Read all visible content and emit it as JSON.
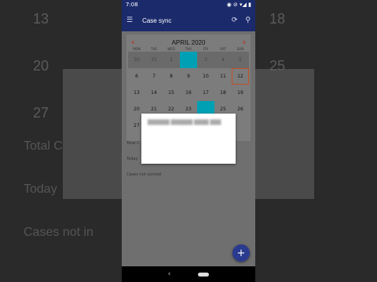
{
  "status_bar": {
    "time": "7:08",
    "right_icons": "◉ ⊘ ▾◢ ▮"
  },
  "app_bar": {
    "title": "Case sync",
    "menu_icon": "☰",
    "sync_icon": "⟳",
    "search_icon": "⚲"
  },
  "calendar": {
    "month_label": "APRIL 2020",
    "prev_icon": "‹",
    "next_icon": "›",
    "weekdays": [
      "MON",
      "TUE",
      "WED",
      "THU",
      "FRI",
      "SAT",
      "SUN"
    ],
    "weeks": [
      [
        {
          "d": "30",
          "out": true
        },
        {
          "d": "31",
          "out": true
        },
        {
          "d": "1",
          "out": true
        },
        {
          "d": "",
          "out": true,
          "sel": true
        },
        {
          "d": "3",
          "out": true
        },
        {
          "d": "4",
          "out": true
        },
        {
          "d": "5",
          "out": true
        }
      ],
      [
        {
          "d": "6"
        },
        {
          "d": "7"
        },
        {
          "d": "8"
        },
        {
          "d": "9"
        },
        {
          "d": "10"
        },
        {
          "d": "11"
        },
        {
          "d": "12",
          "today": true
        }
      ],
      [
        {
          "d": "13"
        },
        {
          "d": "14"
        },
        {
          "d": "15"
        },
        {
          "d": "16"
        },
        {
          "d": "17"
        },
        {
          "d": "18"
        },
        {
          "d": "19"
        }
      ],
      [
        {
          "d": "20"
        },
        {
          "d": "21"
        },
        {
          "d": "22"
        },
        {
          "d": "23"
        },
        {
          "d": "",
          "sel": true
        },
        {
          "d": "25"
        },
        {
          "d": "26"
        }
      ],
      [
        {
          "d": "27"
        },
        {
          "d": "28"
        },
        {
          "d": "29"
        },
        {
          "d": "30"
        },
        {
          "d": ""
        },
        {
          "d": ""
        },
        {
          "d": ""
        }
      ]
    ]
  },
  "below": {
    "line1": "Total C",
    "line2": "Today",
    "line3": "Cases not synced"
  },
  "dialog": {
    "message": "██████ ██████ ████ ███"
  },
  "fab": {
    "icon": "+"
  },
  "nav": {
    "back_icon": "‹"
  },
  "background": {
    "left_numbers": [
      "13",
      "20",
      "27"
    ],
    "right_numbers": [
      "18",
      "25"
    ],
    "left_text": [
      "Total C",
      "Today",
      "Cases not in"
    ]
  }
}
